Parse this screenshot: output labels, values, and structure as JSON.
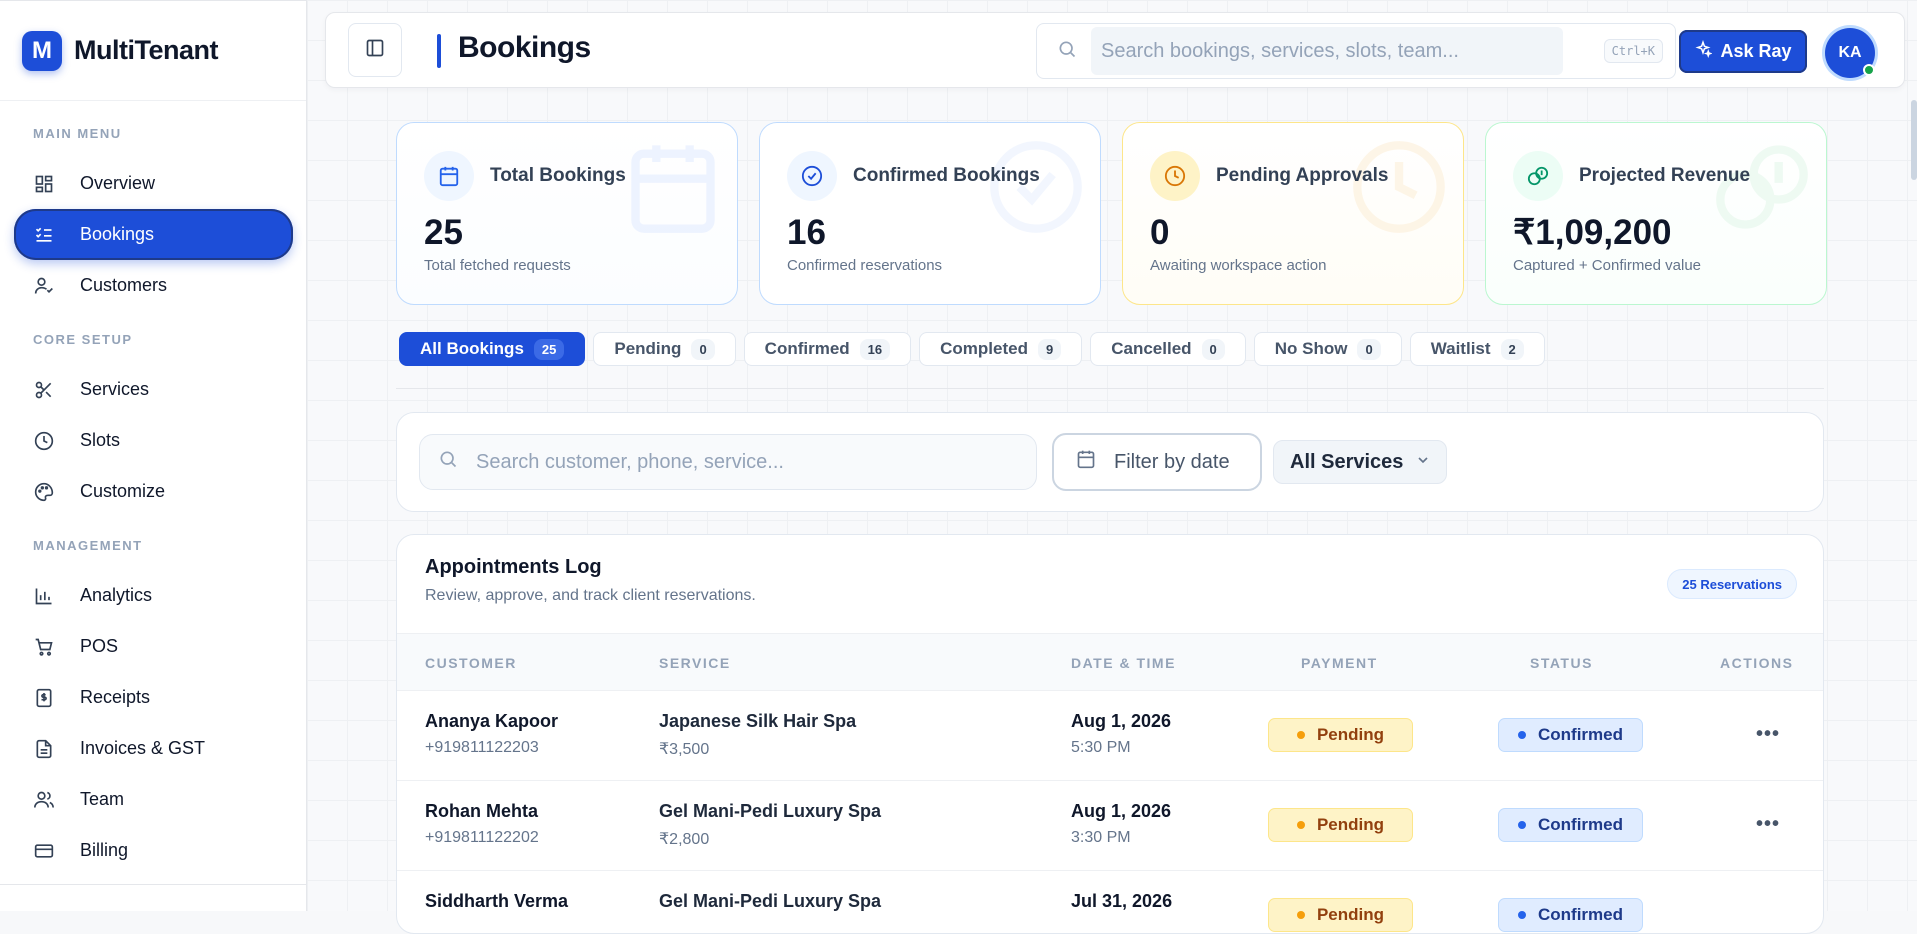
{
  "brand": {
    "logo_letter": "M",
    "name": "MultiTenant"
  },
  "sidebar": {
    "sections": [
      {
        "title": "MAIN MENU",
        "items": [
          {
            "label": "Overview",
            "icon": "grid-icon"
          },
          {
            "label": "Bookings",
            "icon": "list-check-icon",
            "active": true
          },
          {
            "label": "Customers",
            "icon": "user-check-icon"
          }
        ]
      },
      {
        "title": "CORE SETUP",
        "items": [
          {
            "label": "Services",
            "icon": "scissors-icon"
          },
          {
            "label": "Slots",
            "icon": "clock-icon"
          },
          {
            "label": "Customize",
            "icon": "palette-icon"
          }
        ]
      },
      {
        "title": "MANAGEMENT",
        "items": [
          {
            "label": "Analytics",
            "icon": "bar-chart-icon"
          },
          {
            "label": "POS",
            "icon": "cart-icon"
          },
          {
            "label": "Receipts",
            "icon": "receipt-icon"
          },
          {
            "label": "Invoices & GST",
            "icon": "file-icon"
          },
          {
            "label": "Team",
            "icon": "users-icon"
          },
          {
            "label": "Billing",
            "icon": "credit-card-icon"
          }
        ]
      }
    ]
  },
  "header": {
    "title": "Bookings",
    "search_placeholder": "Search bookings, services, slots, team...",
    "shortcut": "Ctrl+K",
    "ask_label": "Ask Ray",
    "avatar_initials": "KA"
  },
  "stats": [
    {
      "label": "Total Bookings",
      "value": "25",
      "sub": "Total fetched requests",
      "icon": "calendar-icon",
      "accent": "#2563eb"
    },
    {
      "label": "Confirmed Bookings",
      "value": "16",
      "sub": "Confirmed reservations",
      "icon": "check-circle-icon",
      "accent": "#1d4ed8"
    },
    {
      "label": "Pending Approvals",
      "value": "0",
      "sub": "Awaiting workspace action",
      "icon": "clock-icon",
      "accent": "#d97706"
    },
    {
      "label": "Projected Revenue",
      "value": "₹1,09,200",
      "sub": "Captured + Confirmed value",
      "icon": "coins-icon",
      "accent": "#059669"
    }
  ],
  "tabs": [
    {
      "label": "All Bookings",
      "count": "25",
      "active": true
    },
    {
      "label": "Pending",
      "count": "0"
    },
    {
      "label": "Confirmed",
      "count": "16"
    },
    {
      "label": "Completed",
      "count": "9"
    },
    {
      "label": "Cancelled",
      "count": "0"
    },
    {
      "label": "No Show",
      "count": "0"
    },
    {
      "label": "Waitlist",
      "count": "2"
    }
  ],
  "filters": {
    "search_placeholder": "Search customer, phone, service...",
    "date_label": "Filter by date",
    "service_selected": "All Services"
  },
  "log": {
    "title": "Appointments Log",
    "subtitle": "Review, approve, and track client reservations.",
    "badge": "25 Reservations",
    "columns": [
      "CUSTOMER",
      "SERVICE",
      "DATE & TIME",
      "PAYMENT",
      "STATUS",
      "ACTIONS"
    ],
    "rows": [
      {
        "name": "Ananya Kapoor",
        "phone": "+919811122203",
        "service": "Japanese Silk Hair Spa",
        "price": "₹3,500",
        "date": "Aug 1, 2026",
        "time": "5:30 PM",
        "payment": "Pending",
        "status": "Confirmed"
      },
      {
        "name": "Rohan Mehta",
        "phone": "+919811122202",
        "service": "Gel Mani-Pedi Luxury Spa",
        "price": "₹2,800",
        "date": "Aug 1, 2026",
        "time": "3:30 PM",
        "payment": "Pending",
        "status": "Confirmed"
      },
      {
        "name": "Siddharth Verma",
        "phone": "",
        "service": "Gel Mani-Pedi Luxury Spa",
        "price": "",
        "date": "Jul 31, 2026",
        "time": "",
        "payment": "Pending",
        "status": "Confirmed"
      }
    ]
  }
}
